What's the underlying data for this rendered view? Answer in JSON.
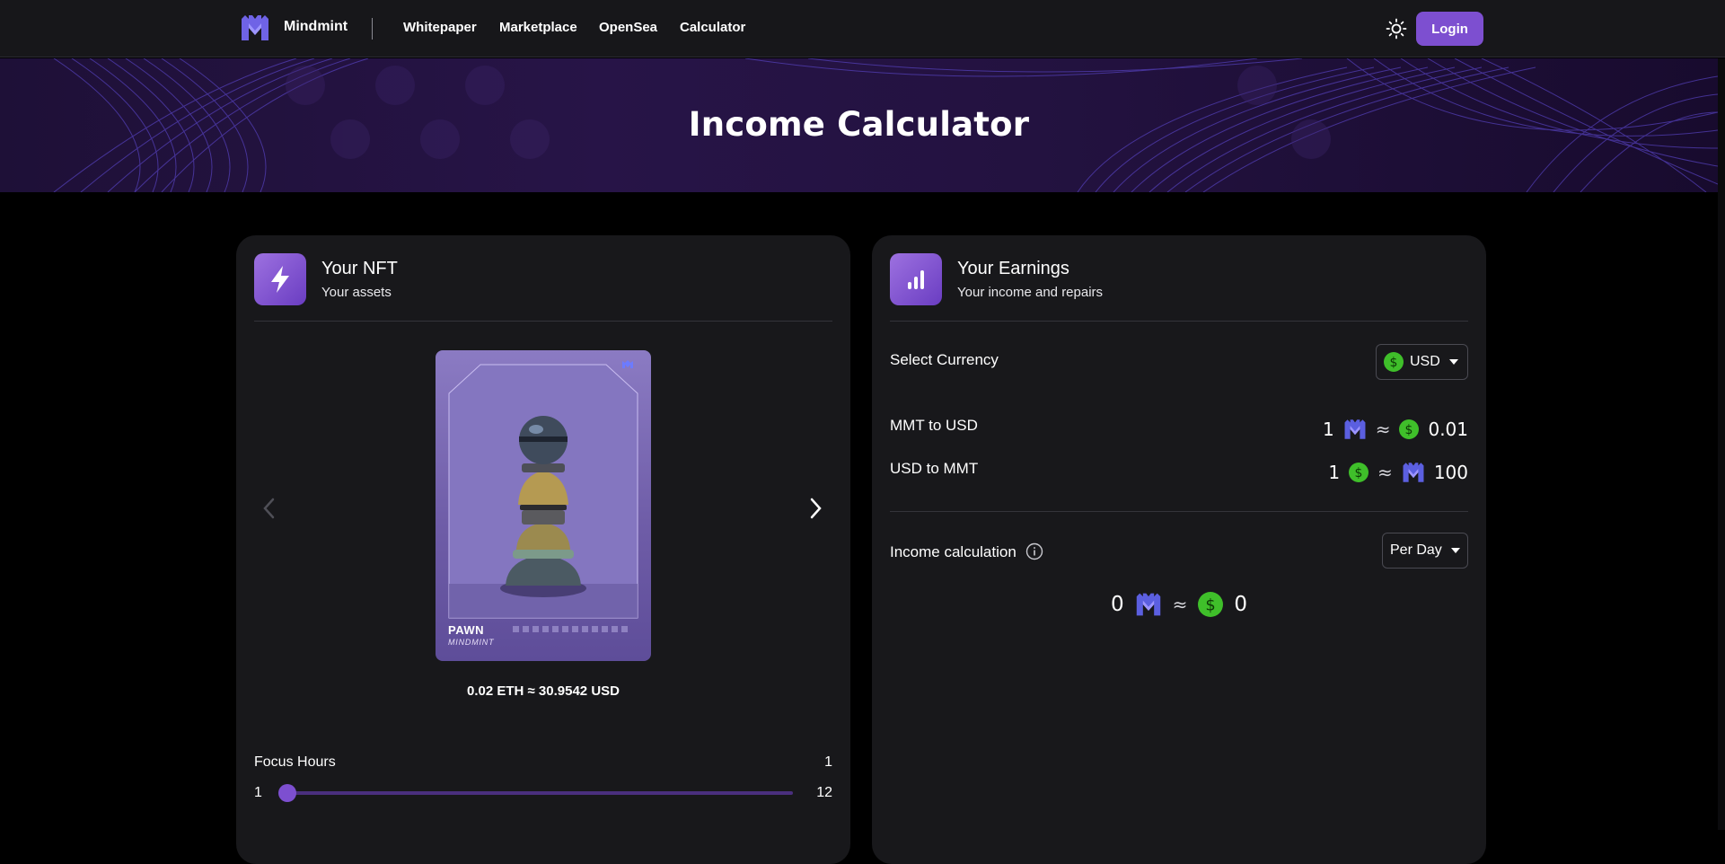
{
  "nav": {
    "brand": "Mindmint",
    "links": [
      "Whitepaper",
      "Marketplace",
      "OpenSea",
      "Calculator"
    ],
    "login_label": "Login",
    "theme_icon": "sun-icon"
  },
  "hero": {
    "title": "Income Calculator"
  },
  "nft_panel": {
    "icon": "lightning-icon",
    "title": "Your NFT",
    "subtitle": "Your assets",
    "nft": {
      "name": "PAWN",
      "brand": "MINDMINT"
    },
    "price": "0.02 ETH ≈ 30.9542 USD",
    "focus": {
      "label": "Focus Hours",
      "value": "1",
      "min": "1",
      "max": "12",
      "current": 1
    }
  },
  "earnings_panel": {
    "icon": "bar-chart-icon",
    "title": "Your Earnings",
    "subtitle": "Your income and repairs",
    "currency_label": "Select Currency",
    "currency_selected": "USD",
    "rates": {
      "mmt_to_usd_label": "MMT to USD",
      "mmt_to_usd_left": "1",
      "mmt_to_usd_right": "0.01",
      "usd_to_mmt_label": "USD to MMT",
      "usd_to_mmt_left": "1",
      "usd_to_mmt_right": "100"
    },
    "income": {
      "label": "Income calculation",
      "period": "Per Day",
      "mmt_value": "0",
      "usd_value": "0"
    },
    "approx_symbol": "≈"
  },
  "colors": {
    "accent": "#7d4fd0",
    "coin_green": "#3fbf2a",
    "mmt_blue": "#5b5fe0"
  }
}
